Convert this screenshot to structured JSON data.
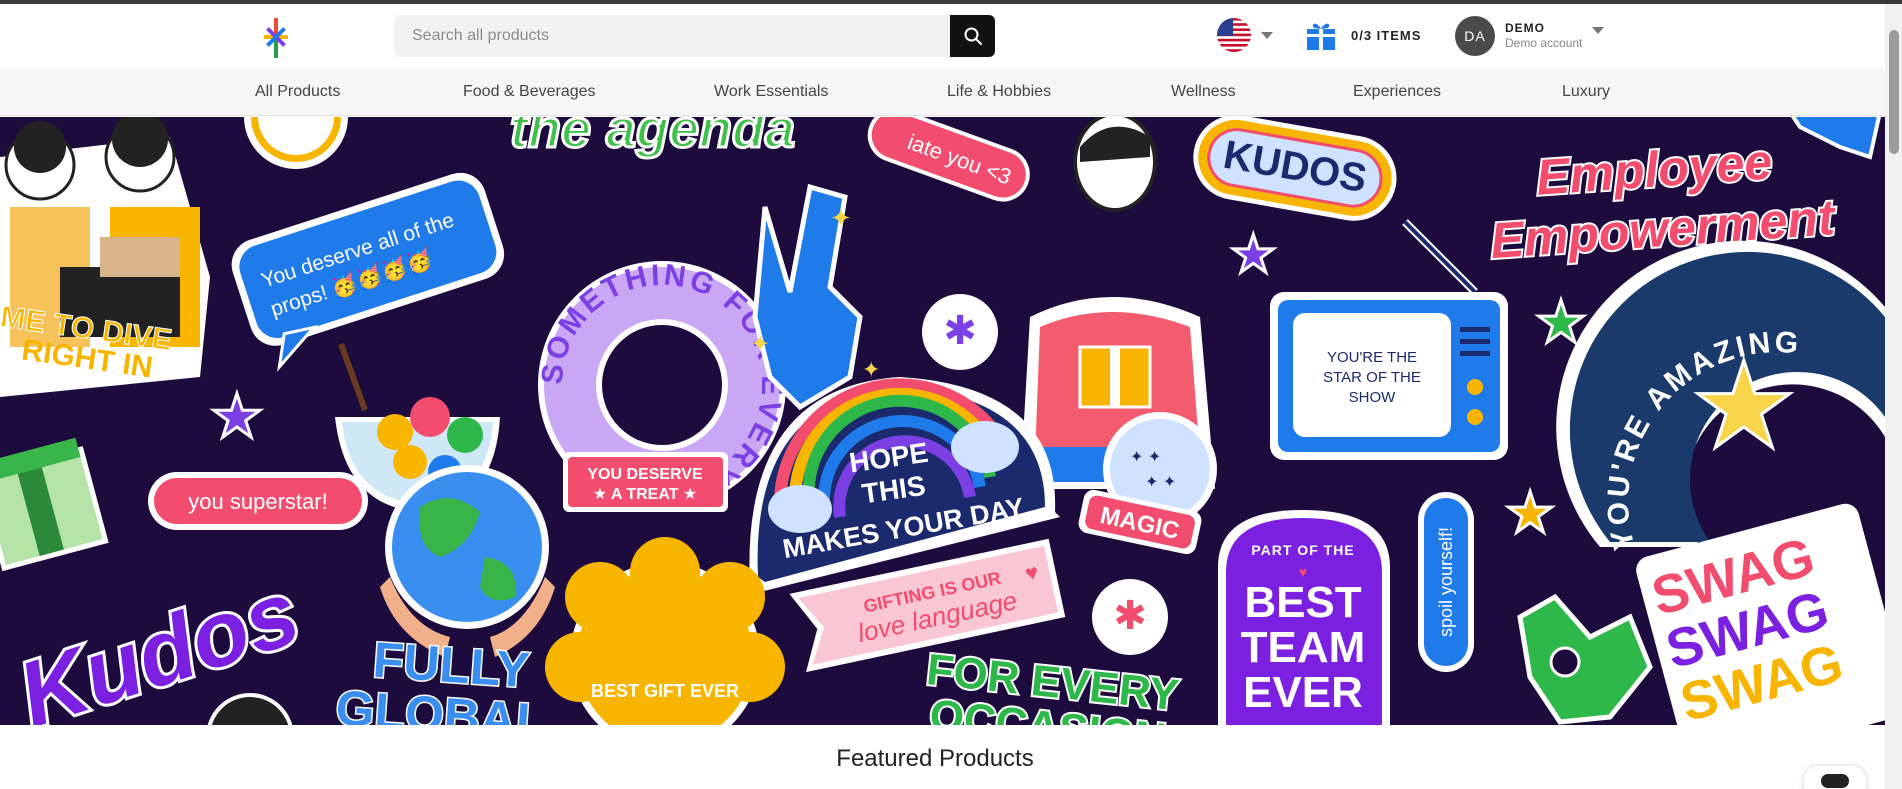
{
  "header": {
    "search": {
      "placeholder": "Search all products"
    },
    "cart": {
      "label": "0/3 ITEMS"
    },
    "account": {
      "initials": "DA",
      "name": "DEMO",
      "subtitle": "Demo account"
    }
  },
  "nav": {
    "items": [
      {
        "label": "All Products"
      },
      {
        "label": "Food & Beverages"
      },
      {
        "label": "Work Essentials"
      },
      {
        "label": "Life & Hobbies"
      },
      {
        "label": "Wellness"
      },
      {
        "label": "Experiences"
      },
      {
        "label": "Luxury"
      }
    ]
  },
  "banner": {
    "stickers": {
      "agenda": "the agenda",
      "appreciate": "iate you <3",
      "kudos_top": "KUDOS",
      "employee1": "Employee",
      "employee2": "Empowerment",
      "props1": "You deserve all of the",
      "props2": "props! 🥳🥳🥳🥳",
      "ring": "SOMETHING FOR EVERYONE",
      "dive1": "IME TO DIVE",
      "dive2": "RIGHT IN",
      "star1": "YOU'RE THE",
      "star2": "STAR OF THE",
      "star3": "SHOW",
      "amazing": "YOU'RE AMAZING",
      "superstar": "you superstar!",
      "treat1": "YOU DESERVE",
      "treat2": "★ A TREAT ★",
      "hope1": "HOPE",
      "hope2": "THIS",
      "hope3": "MAKES YOUR DAY",
      "magic": "MAGIC",
      "gifting1": "GIFTING IS OUR",
      "gifting2": "love language",
      "partof": "PART OF THE",
      "best1": "BEST",
      "best2": "TEAM",
      "best3": "EVER",
      "spoil": "spoil yourself!",
      "kudos_big": "Kudos",
      "fully1": "FULLY",
      "fully2": "GLOBAL",
      "bestgift": "BEST GIFT EVER",
      "occasion1": "FOR EVERY",
      "occasion2": "OCCASION",
      "swag": "SWAG"
    }
  },
  "featured": {
    "title": "Featured Products"
  },
  "colors": {
    "banner_bg": "#1c0b3c",
    "search_button": "#111111",
    "cart_icon": "#1f7aea",
    "nav_bg": "#f6f6f6"
  },
  "icons": {
    "logo": "brand-asterisk-icon",
    "search": "search-icon",
    "flag": "us-flag-icon",
    "cart": "gift-box-icon",
    "account_caret": "chevron-down-icon"
  }
}
